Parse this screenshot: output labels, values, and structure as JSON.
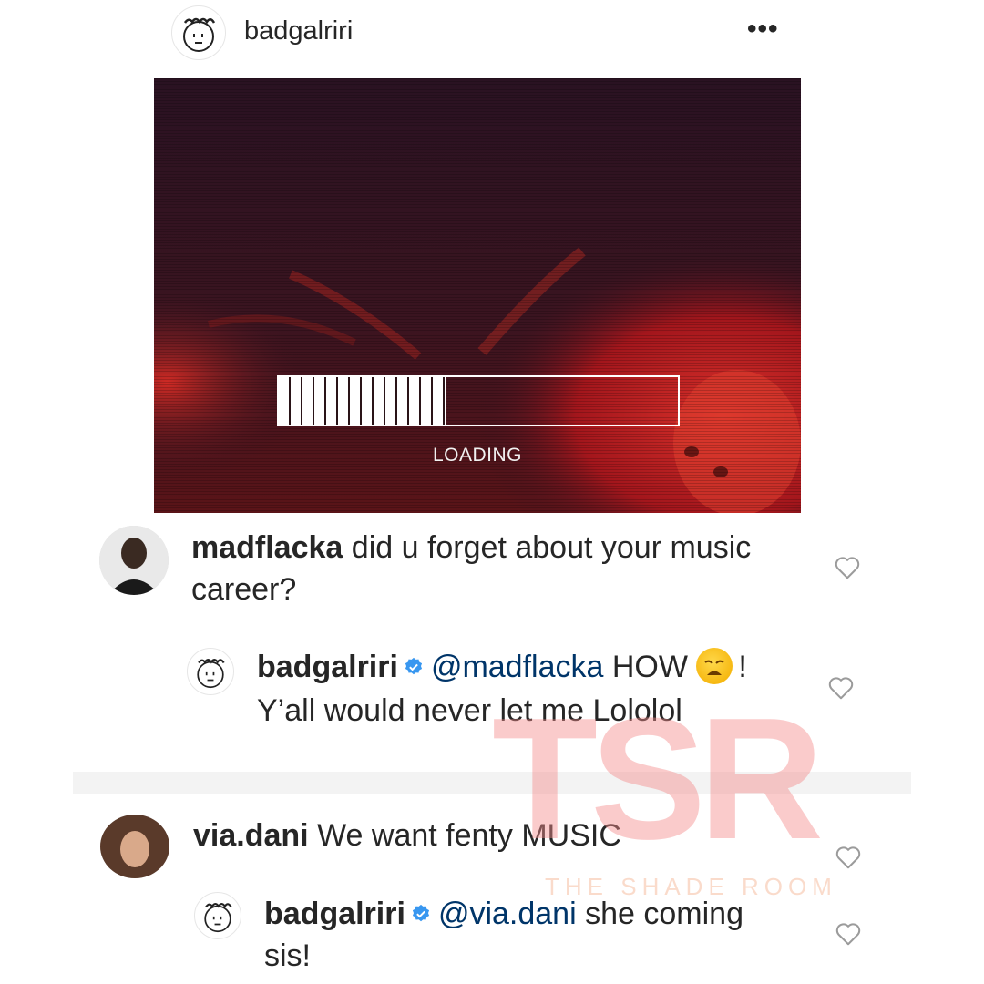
{
  "header": {
    "username": "badgalriri",
    "more_icon": "•••"
  },
  "post": {
    "loading_label": "LOADING",
    "loading_progress_percent": 42
  },
  "comments": [
    {
      "username": "madflacka",
      "text": "did u forget about your music career?"
    },
    {
      "username": "badgalriri",
      "verified": true,
      "mention": "@madflacka",
      "text_a": "HOW",
      "emoji": "weary-face",
      "text_b": "! Y’all would never let me Lololol"
    },
    {
      "username": "via.dani",
      "text": "We want fenty MUSIC"
    },
    {
      "username": "badgalriri",
      "verified": true,
      "mention": "@via.dani",
      "text": "she coming sis!"
    }
  ],
  "watermark": {
    "letters": "TSR",
    "subtitle": "THE SHADE ROOM"
  }
}
